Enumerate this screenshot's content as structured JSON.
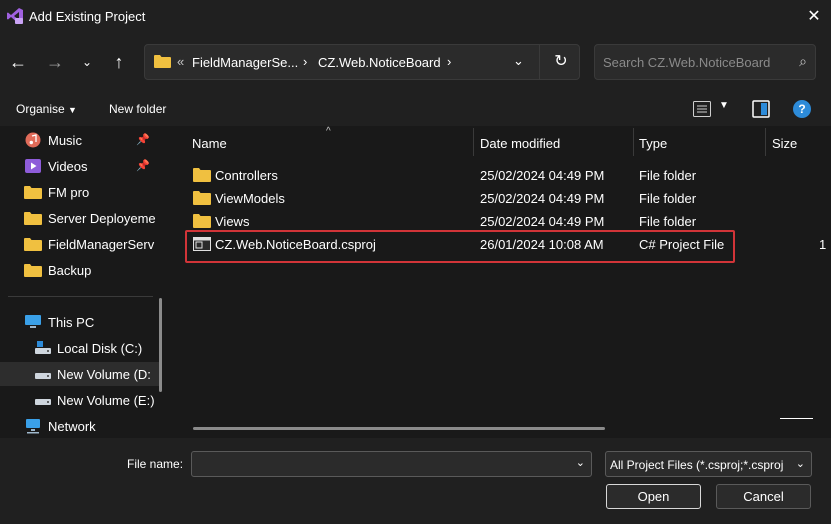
{
  "window": {
    "title": "Add Existing Project"
  },
  "nav": {
    "breadcrumb": [
      "FieldManagerSe...",
      "CZ.Web.NoticeBoard"
    ],
    "search_placeholder": "Search CZ.Web.NoticeBoard"
  },
  "toolbar": {
    "organise": "Organise",
    "new_folder": "New folder"
  },
  "sidebar": {
    "items": [
      {
        "label": "Music",
        "icon": "music-icon",
        "pinned": true
      },
      {
        "label": "Videos",
        "icon": "videos-icon",
        "pinned": true
      },
      {
        "label": "FM pro",
        "icon": "folder-icon"
      },
      {
        "label": "Server Deployeme",
        "icon": "folder-icon"
      },
      {
        "label": "FieldManagerServ",
        "icon": "folder-icon"
      },
      {
        "label": "Backup",
        "icon": "folder-icon"
      }
    ],
    "this_pc": "This PC",
    "drives": [
      {
        "label": "Local Disk (C:)"
      },
      {
        "label": "New Volume (D:",
        "selected": true
      },
      {
        "label": "New Volume (E:)"
      }
    ],
    "network": "Network"
  },
  "columns": {
    "name": "Name",
    "date": "Date modified",
    "type": "Type",
    "size": "Size"
  },
  "files": [
    {
      "name": "Controllers",
      "date": "25/02/2024 04:49 PM",
      "type": "File folder",
      "size": ""
    },
    {
      "name": "ViewModels",
      "date": "25/02/2024 04:49 PM",
      "type": "File folder",
      "size": ""
    },
    {
      "name": "Views",
      "date": "25/02/2024 04:49 PM",
      "type": "File folder",
      "size": ""
    },
    {
      "name": "CZ.Web.NoticeBoard.csproj",
      "date": "26/01/2024 10:08 AM",
      "type": "C# Project File",
      "size": "1",
      "highlighted": true
    }
  ],
  "footer": {
    "file_name_label": "File name:",
    "file_name_value": "",
    "filter": "All Project Files (*.csproj;*.csproj",
    "open": "Open",
    "cancel": "Cancel"
  },
  "colors": {
    "background": "#191919",
    "chrome": "#202020",
    "folder": "#f0c040",
    "highlight": "#d13438",
    "accent": "#2d8bd9"
  }
}
